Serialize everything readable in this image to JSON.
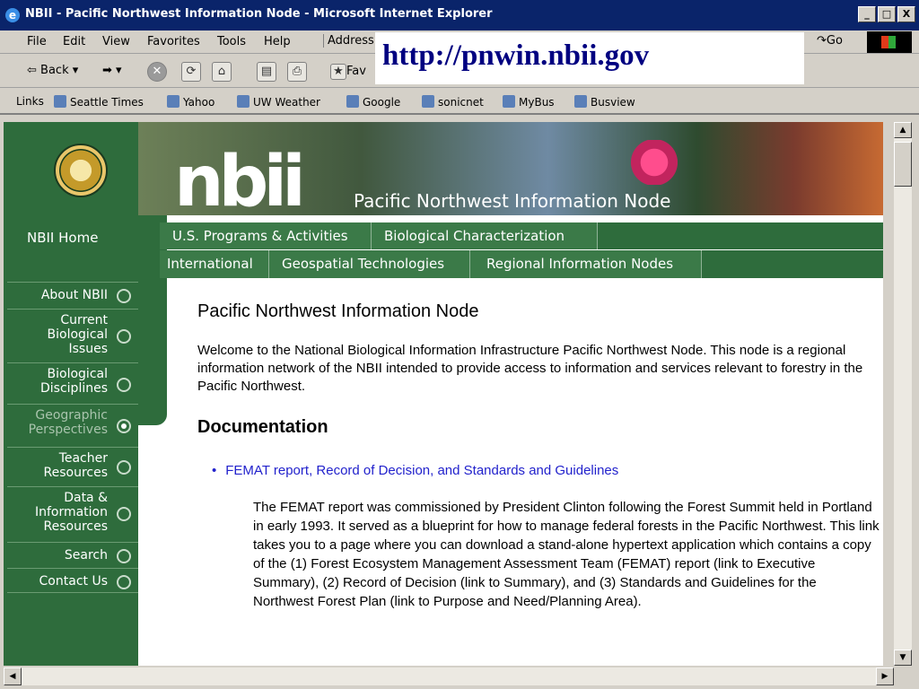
{
  "window": {
    "title": "NBII - Pacific Northwest Information Node - Microsoft Internet Explorer",
    "buttons": [
      "_",
      "□",
      "X"
    ]
  },
  "menubar": {
    "items": [
      "File",
      "Edit",
      "View",
      "Favorites",
      "Tools",
      "Help"
    ],
    "address_label": "Address",
    "go_label": "Go"
  },
  "toolbar": {
    "back_label": "Back",
    "favorites_label": "Fav"
  },
  "url_overlay": "http://pnwin.nbii.gov",
  "links": {
    "label": "Links",
    "items": [
      "Seattle Times",
      "Yahoo",
      "UW Weather",
      "Google",
      "sonicnet",
      "MyBus",
      "Busview"
    ]
  },
  "banner": {
    "logo_text": "nbii",
    "title": "Pacific Northwest Information Node"
  },
  "sidebar": {
    "home": "NBII Home",
    "items": [
      {
        "label": "About NBII",
        "selected": false
      },
      {
        "label": "Current Biological Issues",
        "selected": false
      },
      {
        "label": "Biological Disciplines",
        "selected": false
      },
      {
        "label": "Geographic Perspectives",
        "selected": true
      },
      {
        "label": "Teacher Resources",
        "selected": false
      },
      {
        "label": "Data & Information Resources",
        "selected": false
      },
      {
        "label": "Search",
        "selected": false
      },
      {
        "label": "Contact Us",
        "selected": false
      }
    ]
  },
  "tabs": {
    "row1": [
      "U.S. Programs & Activities",
      "Biological Characterization"
    ],
    "row2": [
      "International",
      "Geospatial Technologies",
      "Regional Information Nodes"
    ]
  },
  "content": {
    "heading": "Pacific Northwest Information Node",
    "welcome": "Welcome to the National Biological Information Infrastructure Pacific Northwest Node. This node is a regional information network of the NBII intended to provide access to information and services relevant to forestry in the Pacific Northwest.",
    "documentation_heading": "Documentation",
    "link_text": "FEMAT report, Record of Decision, and Standards and Guidelines",
    "description": "The FEMAT report was commissioned by President Clinton following the Forest Summit held in Portland in early 1993.  It served as a blueprint for how to manage federal forests in the Pacific Northwest.  This link takes you to a page where you can download a stand-alone hypertext application which contains a copy of the (1) Forest Ecosystem Management Assessment Team (FEMAT) report (link to Executive Summary), (2) Record of Decision (link to Summary), and (3) Standards and Guidelines for the Northwest Forest Plan (link to Purpose and Need/Planning Area)."
  },
  "colors": {
    "title_bar": "#0a246a",
    "nav_green": "#2e6c3c",
    "link_blue": "#2222cc"
  }
}
